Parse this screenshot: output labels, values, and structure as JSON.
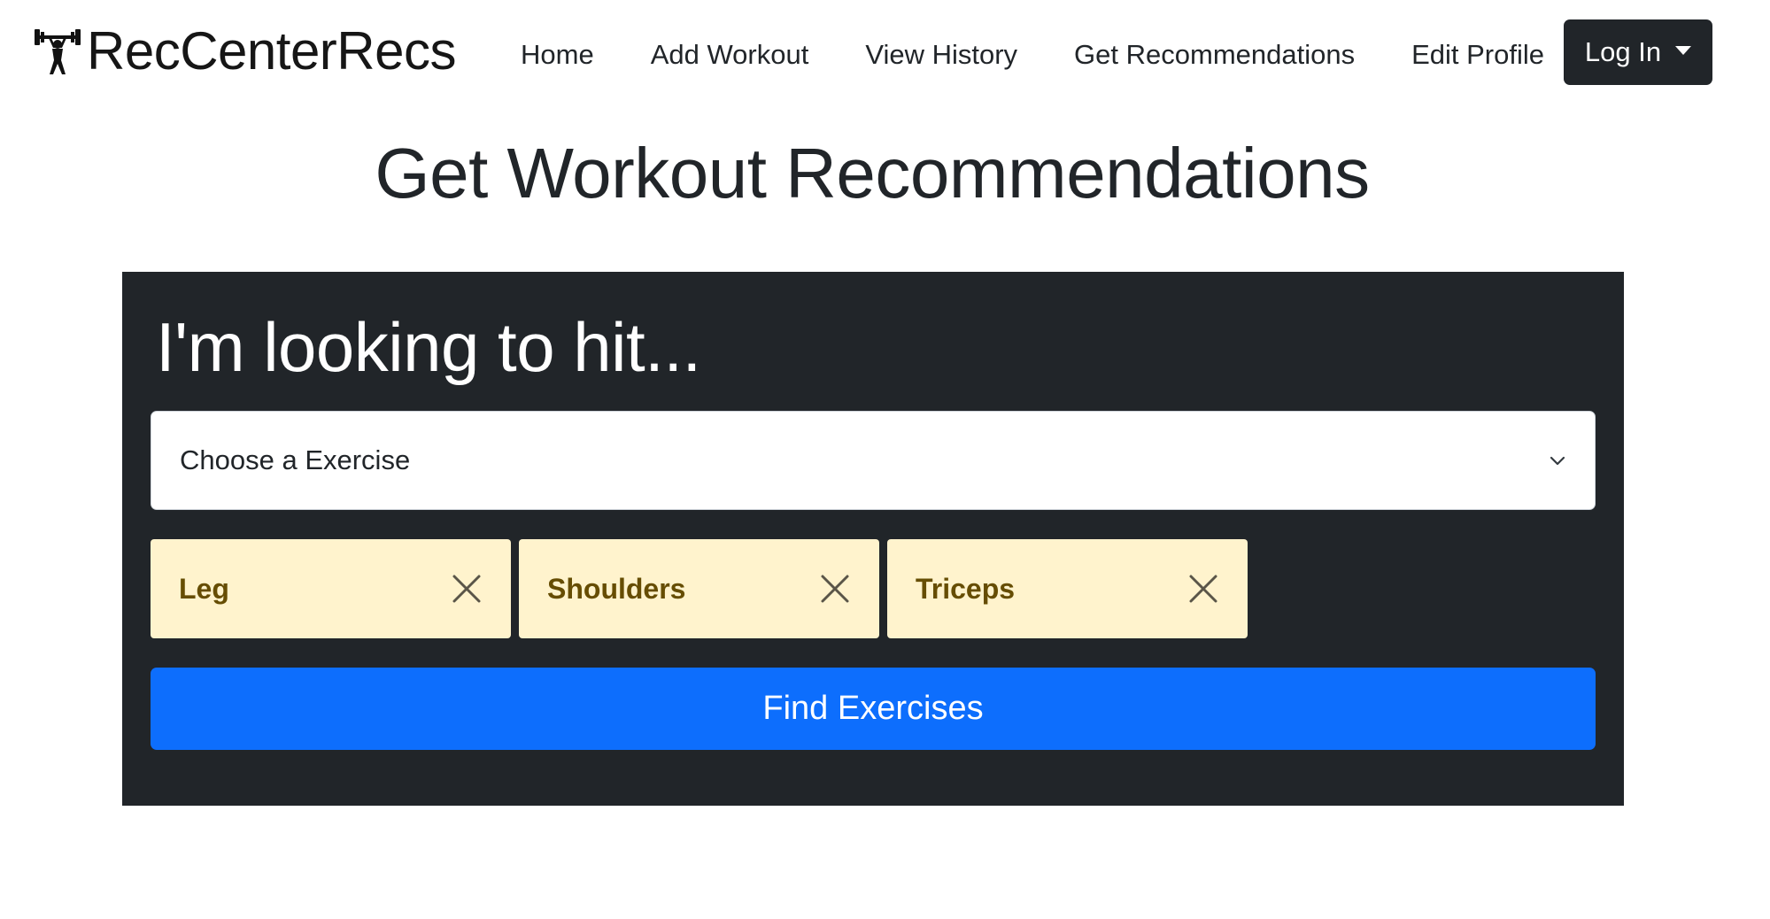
{
  "navbar": {
    "brand": "RecCenterRecs",
    "brand_icon": "weightlifter-icon",
    "links": {
      "home": "Home",
      "add_workout": "Add Workout",
      "view_history": "View History",
      "get_recommendations": "Get Recommendations",
      "edit_profile": "Edit Profile"
    },
    "login_label": "Log In"
  },
  "page": {
    "title": "Get Workout Recommendations"
  },
  "card": {
    "heading": "I'm looking to hit...",
    "select": {
      "value": "Choose a Exercise"
    },
    "tags": [
      {
        "label": "Leg"
      },
      {
        "label": "Shoulders"
      },
      {
        "label": "Triceps"
      }
    ],
    "find_button": "Find Exercises"
  },
  "colors": {
    "dark": "#212529",
    "primary": "#0d6efd",
    "tag_bg": "#fff3cd",
    "tag_text": "#664d03"
  }
}
